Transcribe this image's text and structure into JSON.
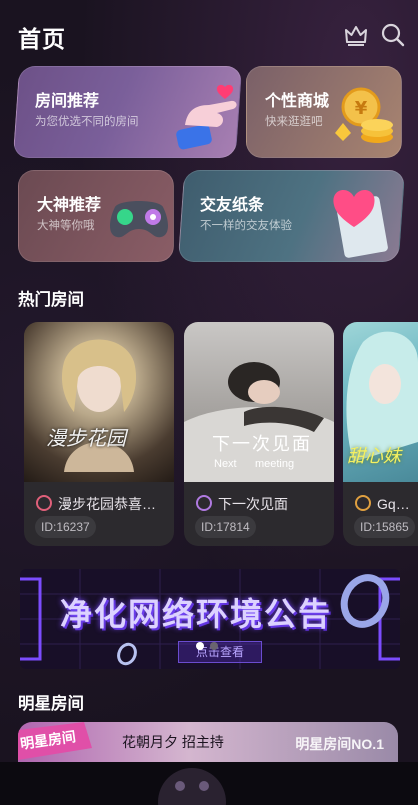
{
  "header": {
    "title": "首页",
    "crown_icon": "crown-icon",
    "search_icon": "search-icon"
  },
  "quick_cards": [
    {
      "title": "房间推荐",
      "subtitle": "为您优选不同的房间"
    },
    {
      "title": "个性商城",
      "subtitle": "快来逛逛吧"
    },
    {
      "title": "大神推荐",
      "subtitle": "大神等你哦"
    },
    {
      "title": "交友纸条",
      "subtitle": "不一样的交友体验"
    }
  ],
  "hot_rooms": {
    "title": "热门房间",
    "items": [
      {
        "name": "漫步花园恭喜…",
        "id": "ID:16237",
        "overlay": "漫步花园",
        "icon_color": "#e0607a"
      },
      {
        "name": "下一次见面",
        "id": "ID:17814",
        "overlay": "下一次见面",
        "overlay2": "Next      meeting",
        "icon_color": "#b07ae0"
      },
      {
        "name": "Gq丶甜",
        "id": "ID:15865",
        "overlay": "甜心妹",
        "icon_color": "#e0a040"
      }
    ]
  },
  "banner": {
    "text": "净化网络环境公告",
    "button": "点击查看"
  },
  "star_rooms": {
    "title": "明星房间",
    "tag": "明星房间",
    "host": "花朝月夕 招主持",
    "rank": "明星房间NO.1"
  }
}
